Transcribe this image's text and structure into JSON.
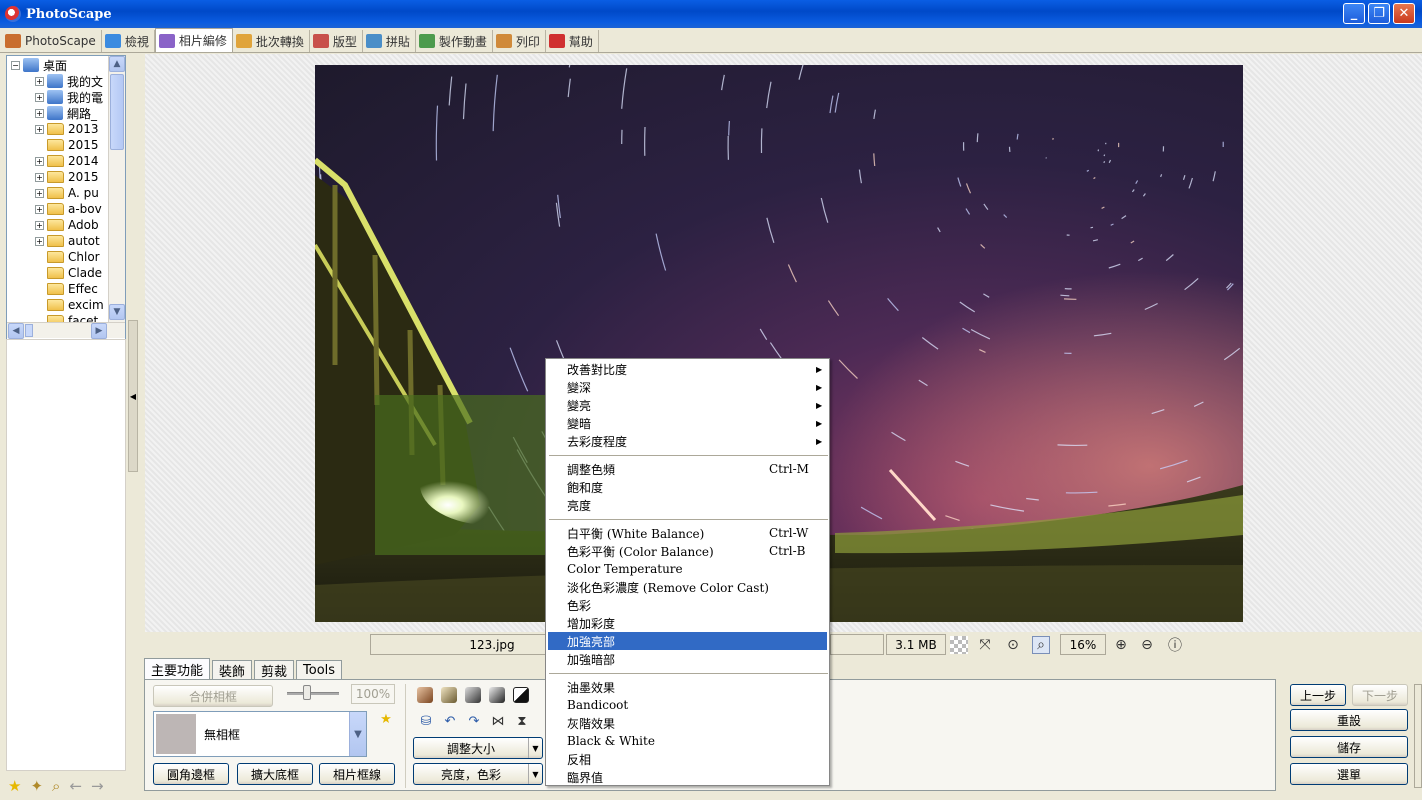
{
  "window": {
    "title": "PhotoScape",
    "min_label": "_",
    "max_label": "❐",
    "close_label": "✕"
  },
  "tabs": [
    {
      "label": "PhotoScape",
      "color": "#c96e2f"
    },
    {
      "label": "檢視",
      "color": "#3b8be0"
    },
    {
      "label": "相片編修",
      "color": "#8a63c8"
    },
    {
      "label": "批次轉換",
      "color": "#e0a43b"
    },
    {
      "label": "版型",
      "color": "#c8504a"
    },
    {
      "label": "拼貼",
      "color": "#4a8ec8"
    },
    {
      "label": "製作動畫",
      "color": "#4d9b4d"
    },
    {
      "label": "列印",
      "color": "#d08a3a"
    },
    {
      "label": "幫助",
      "color": "#d03030"
    }
  ],
  "active_tab": "相片編修",
  "tree": {
    "root": "桌面",
    "items": [
      {
        "label": "我的文",
        "type": "drive",
        "expandable": true
      },
      {
        "label": "我的電",
        "type": "drive",
        "expandable": true
      },
      {
        "label": "網路_",
        "type": "drive",
        "expandable": true
      },
      {
        "label": "2013",
        "type": "folder",
        "expandable": true
      },
      {
        "label": "2015",
        "type": "folder",
        "expandable": false
      },
      {
        "label": "2014",
        "type": "folder",
        "expandable": true
      },
      {
        "label": "2015",
        "type": "folder",
        "expandable": true
      },
      {
        "label": "A. pu",
        "type": "folder",
        "expandable": true
      },
      {
        "label": "a-bov",
        "type": "folder",
        "expandable": true
      },
      {
        "label": "Adob",
        "type": "folder",
        "expandable": true
      },
      {
        "label": "autot",
        "type": "folder",
        "expandable": true
      },
      {
        "label": "Chlor",
        "type": "folder",
        "expandable": false
      },
      {
        "label": "Clade",
        "type": "folder",
        "expandable": false
      },
      {
        "label": "Effec",
        "type": "folder",
        "expandable": false
      },
      {
        "label": "excim",
        "type": "folder",
        "expandable": false
      },
      {
        "label": "facet",
        "type": "folder",
        "expandable": false
      }
    ]
  },
  "status": {
    "filename": "123.jpg",
    "filesize": "3.1 MB",
    "zoom": "16%"
  },
  "edit_tabs": [
    {
      "label": "主要功能"
    },
    {
      "label": "裝飾"
    },
    {
      "label": "剪裁"
    },
    {
      "label": "Tools"
    }
  ],
  "edit": {
    "merge_frame": "合併相框",
    "frame_pct": "100%",
    "frame_name": "無相框",
    "round_corner": "圓角邊框",
    "expand_canvas": "擴大底框",
    "frame_line": "相片框線",
    "resize": "調整大小",
    "bright_color": "亮度，色彩"
  },
  "right_buttons": {
    "undo": "上一步",
    "redo": "下一步",
    "reset": "重設",
    "save": "儲存",
    "menu": "選單"
  },
  "context_menu": {
    "groups": [
      [
        {
          "label": "改善對比度",
          "submenu": true
        },
        {
          "label": "變深",
          "submenu": true
        },
        {
          "label": "變亮",
          "submenu": true
        },
        {
          "label": "變暗",
          "submenu": true
        },
        {
          "label": "去彩度程度",
          "submenu": true
        }
      ],
      [
        {
          "label": "調整色頻",
          "shortcut": "Ctrl-M"
        },
        {
          "label": "飽和度"
        },
        {
          "label": "亮度"
        }
      ],
      [
        {
          "label": "白平衡 (White Balance)",
          "shortcut": "Ctrl-W"
        },
        {
          "label": "色彩平衡 (Color Balance)",
          "shortcut": "Ctrl-B"
        },
        {
          "label": "Color Temperature"
        },
        {
          "label": "淡化色彩濃度 (Remove Color Cast)"
        },
        {
          "label": "色彩"
        },
        {
          "label": "增加彩度"
        },
        {
          "label": "加強亮部",
          "highlighted": true
        },
        {
          "label": "加強暗部"
        }
      ],
      [
        {
          "label": "油墨效果"
        },
        {
          "label": "Bandicoot"
        },
        {
          "label": "灰階效果"
        },
        {
          "label": "Black & White"
        },
        {
          "label": "反相"
        },
        {
          "label": "臨界值"
        }
      ]
    ]
  }
}
